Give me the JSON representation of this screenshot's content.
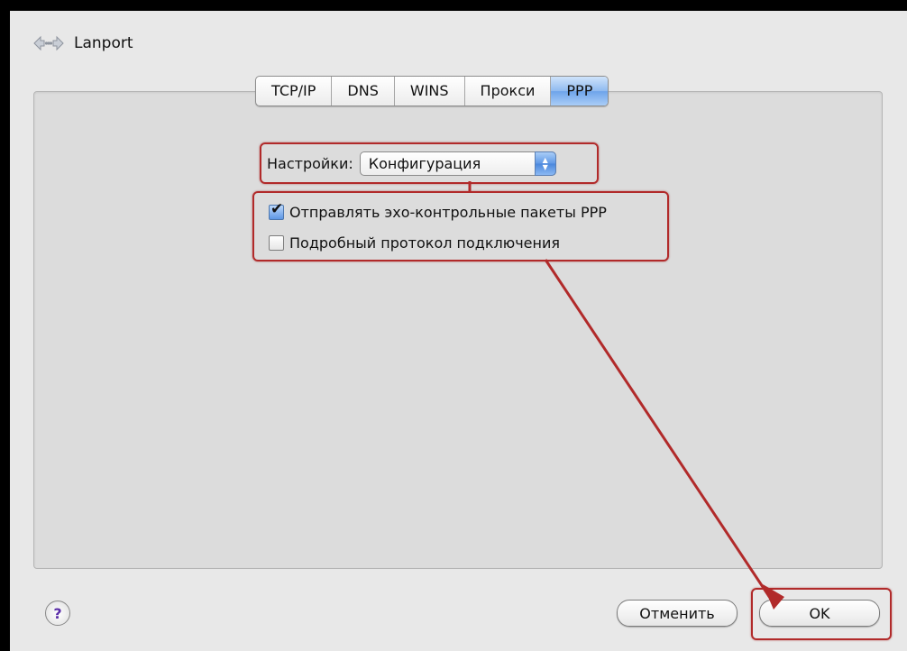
{
  "window": {
    "title": "Lanport",
    "icon": "network-arrows-icon"
  },
  "tabs": [
    {
      "label": "TCP/IP",
      "active": false
    },
    {
      "label": "DNS",
      "active": false
    },
    {
      "label": "WINS",
      "active": false
    },
    {
      "label": "Прокси",
      "active": false
    },
    {
      "label": "PPP",
      "active": true
    }
  ],
  "settings": {
    "label": "Настройки:",
    "selected": "Конфигурация"
  },
  "options": [
    {
      "label": "Отправлять эхо-контрольные пакеты PPP",
      "checked": true
    },
    {
      "label": "Подробный протокол подключения",
      "checked": false
    }
  ],
  "footer": {
    "help": "?",
    "cancel_label": "Отменить",
    "ok_label": "OK"
  },
  "colors": {
    "highlight": "#b12a2a",
    "accent": "#5f98e6"
  }
}
